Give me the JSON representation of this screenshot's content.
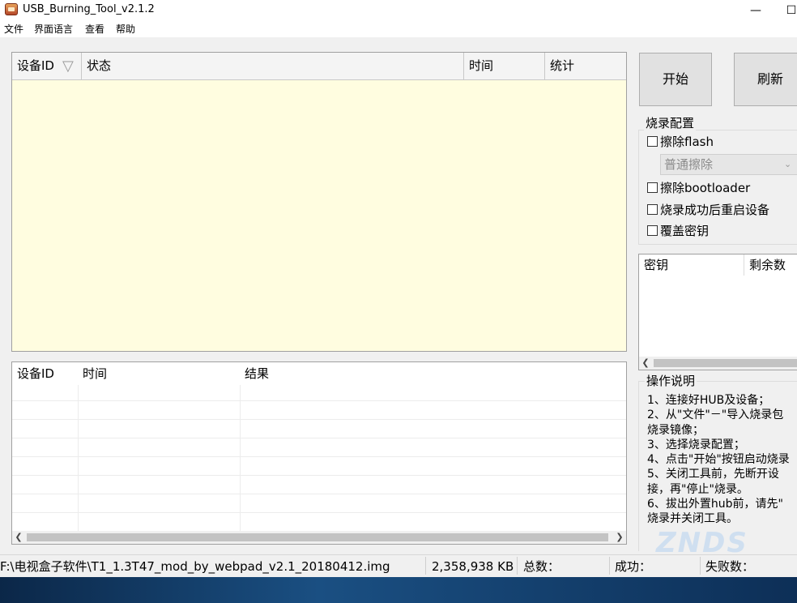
{
  "window": {
    "title": "USB_Burning_Tool_v2.1.2",
    "minimize_glyph": "—",
    "maximize_glyph": "☐"
  },
  "menu": [
    "文件",
    "界面语言",
    "查看",
    "帮助"
  ],
  "device_table": {
    "columns": [
      "设备ID",
      "状态",
      "时间",
      "统计"
    ],
    "sort_glyph": "▽"
  },
  "result_table": {
    "columns": [
      "设备ID",
      "时间",
      "结果"
    ]
  },
  "buttons": {
    "start": "开始",
    "refresh": "刷新"
  },
  "burn_config": {
    "title": "烧录配置",
    "erase_flash": "擦除flash",
    "erase_mode": "普通擦除",
    "erase_bootloader": "擦除bootloader",
    "reboot_after": "烧录成功后重启设备",
    "overwrite_key": "覆盖密钥"
  },
  "key_table": {
    "columns": [
      "密钥",
      "剩余数"
    ]
  },
  "instructions": {
    "title": "操作说明",
    "text": "1、连接好HUB及设备；\n2、从\"文件\"－\"导入烧录包\n烧录镜像；\n3、选择烧录配置；\n4、点击\"开始\"按钮启动烧录\n5、关闭工具前，先断开设\n接，再\"停止\"烧录。\n6、拔出外置hub前，请先\"\n烧录并关闭工具。"
  },
  "status_bar": {
    "path": "F:\\电视盒子软件\\T1_1.3T47_mod_by_webpad_v2.1_20180412.img",
    "size": "2,358,938 KB",
    "total_label": "总数：",
    "success_label": "成功：",
    "fail_label": "失败数："
  },
  "watermark": "ZNDS"
}
